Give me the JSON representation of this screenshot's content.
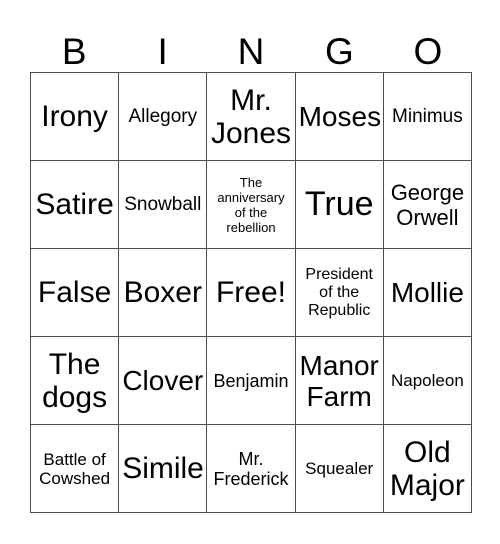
{
  "card": {
    "title": "BINGO",
    "header_letters": [
      "B",
      "I",
      "N",
      "G",
      "O"
    ],
    "colors": {
      "background": "#ffffff",
      "text": "#000000",
      "grid_line": "#4d4d4d"
    },
    "grid": {
      "columns": 5,
      "rows": 5,
      "free_space_label": "Free!"
    },
    "cells": [
      {
        "text": "Irony",
        "size": "sz-xl"
      },
      {
        "text": "Allegory",
        "size": "sz-m2"
      },
      {
        "text": "Mr.\nJones",
        "size": "sz-xl"
      },
      {
        "text": "Moses",
        "size": "sz-l"
      },
      {
        "text": "Minimus",
        "size": "sz-m2"
      },
      {
        "text": "Satire",
        "size": "sz-xl"
      },
      {
        "text": "Snowball",
        "size": "sz-m2"
      },
      {
        "text": "The\nanniversary\nof the\nrebellion",
        "size": "sz-xs"
      },
      {
        "text": "True",
        "size": "sz-xxl"
      },
      {
        "text": "George\nOrwell",
        "size": "sz-ml"
      },
      {
        "text": "False",
        "size": "sz-xl"
      },
      {
        "text": "Boxer",
        "size": "sz-xl"
      },
      {
        "text": "Free!",
        "size": "sz-xl"
      },
      {
        "text": "President\nof the\nRepublic",
        "size": "sz-s"
      },
      {
        "text": "Mollie",
        "size": "sz-l"
      },
      {
        "text": "The\ndogs",
        "size": "sz-xl"
      },
      {
        "text": "Clover",
        "size": "sz-l"
      },
      {
        "text": "Benjamin",
        "size": "sz-m"
      },
      {
        "text": "Manor\nFarm",
        "size": "sz-l"
      },
      {
        "text": "Napoleon",
        "size": "sz-s2"
      },
      {
        "text": "Battle of\nCowshed",
        "size": "sz-s2"
      },
      {
        "text": "Simile",
        "size": "sz-xl"
      },
      {
        "text": "Mr.\nFrederick",
        "size": "sz-m"
      },
      {
        "text": "Squealer",
        "size": "sz-s2"
      },
      {
        "text": "Old\nMajor",
        "size": "sz-xl"
      }
    ]
  }
}
